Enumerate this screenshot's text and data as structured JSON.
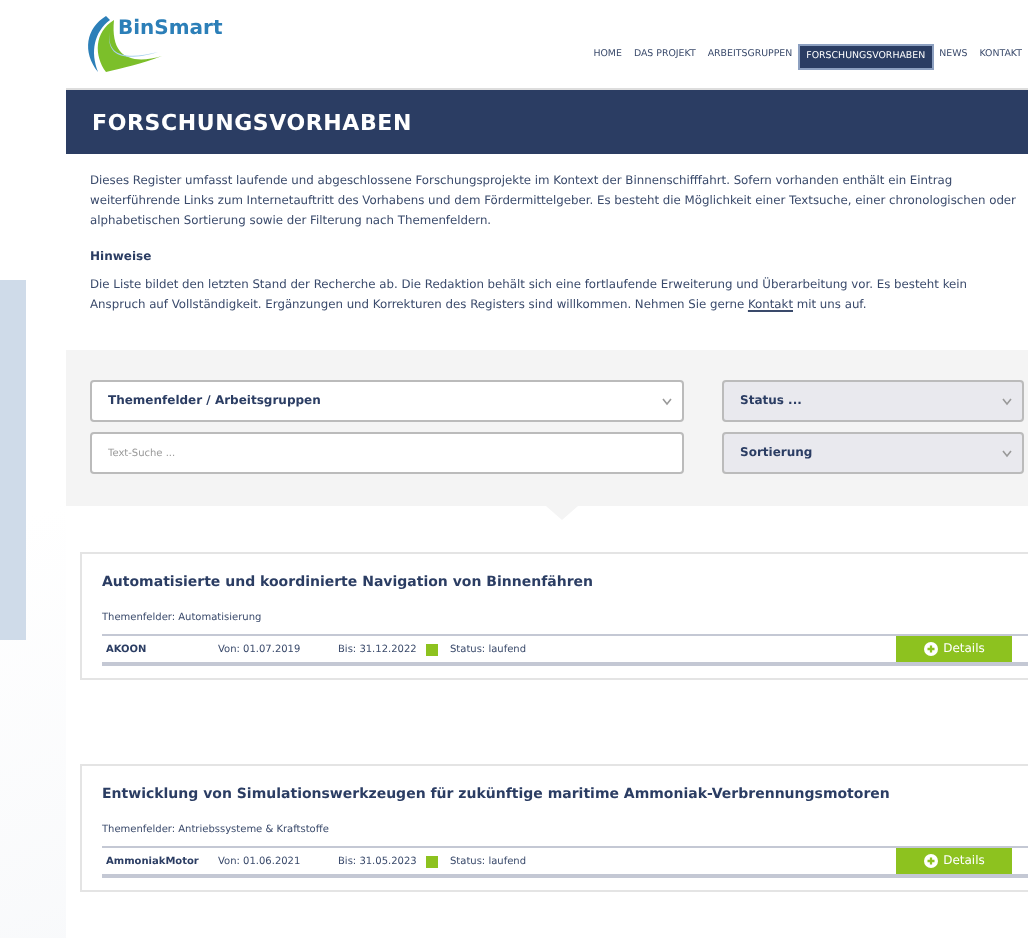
{
  "logo": {
    "text": "BinSmart"
  },
  "nav": [
    {
      "label": "HOME",
      "selected": false
    },
    {
      "label": "DAS PROJEKT",
      "selected": false
    },
    {
      "label": "ARBEITSGRUPPEN",
      "selected": false
    },
    {
      "label": "FORSCHUNGSVORHABEN",
      "selected": true
    },
    {
      "label": "NEWS",
      "selected": false
    },
    {
      "label": "KONTAKT",
      "selected": false
    }
  ],
  "page_title": "FORSCHUNGSVORHABEN",
  "intro": "Dieses Register umfasst laufende und abgeschlossene Forschungsprojekte im Kontext der Binnenschifffahrt. Sofern vorhanden enthält ein Eintrag weiterführende Links zum Internetauftritt des Vorhabens und dem Fördermittelgeber. Es besteht die Möglichkeit einer Textsuche, einer chronologischen oder alphabetischen Sortierung sowie der Filterung nach Themenfeldern.",
  "notes": {
    "heading": "Hinweise",
    "text_before": "Die Liste bildet den letzten Stand der Recherche ab. Die Redaktion behält sich eine fortlaufende Erweiterung und Überarbeitung vor. Es besteht kein Anspruch auf Vollständigkeit. Ergänzungen und Korrekturen des Registers sind willkommen. Nehmen Sie gerne",
    "link": "Kontakt",
    "text_after": "mit uns auf."
  },
  "filters": [
    {
      "kind": "select",
      "value": "Themenfelder / Arbeitsgruppen"
    },
    {
      "kind": "select",
      "value": "Status ..."
    },
    {
      "kind": "text",
      "placeholder": "Text-Suche ..."
    },
    {
      "kind": "select",
      "value": "Sortierung"
    }
  ],
  "projects": [
    {
      "title": "Automatisierte und koordinierte Navigation von Binnenfähren",
      "topics": "Themenfelder: Automatisierung",
      "acronym": "AKOON",
      "from": "Von: 01.07.2019",
      "to": "Bis: 31.12.2022",
      "status": "Status: laufend",
      "color": "#8dc21f",
      "button": "Details"
    },
    {
      "title": "Entwicklung von Simulationswerkzeugen für zukünftige maritime Ammoniak-Verbrennungsmotoren",
      "topics": "Themenfelder: Antriebssysteme & Kraftstoffe",
      "acronym": "AmmoniakMotor",
      "from": "Von: 01.06.2021",
      "to": "Bis: 31.05.2023",
      "status": "Status: laufend",
      "color": "#8dc21f",
      "button": "Details"
    }
  ]
}
